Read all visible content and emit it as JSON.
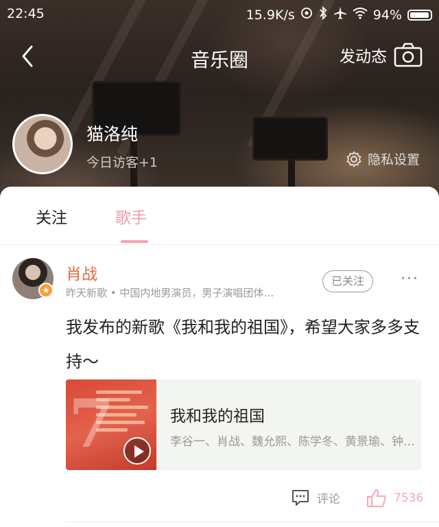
{
  "status_bar": {
    "time": "22:45",
    "network_speed": "15.9K/s",
    "battery": "94%"
  },
  "nav": {
    "title": "音乐圈",
    "post_label": "发动态"
  },
  "profile": {
    "name": "猫洛纯",
    "visits": "今日访客+1",
    "privacy_label": "隐私设置"
  },
  "tabs": [
    {
      "label": "关注"
    },
    {
      "label": "歌手",
      "active": true
    }
  ],
  "post": {
    "author": "肖战",
    "meta": "昨天新歌 • 中国内地男演员，男子演唱团体…",
    "follow_status": "已关注",
    "more": "···",
    "text": "我发布的新歌《我和我的祖国》，希望大家多多支持～",
    "song": {
      "title": "我和我的祖国",
      "artists": "李谷一、肖战、魏允熙、陈学冬、黄景瑜、钟…"
    },
    "comment_label": "评论",
    "like_count": "7536"
  },
  "colors": {
    "accent_pink": "#f09aa8",
    "author_orange": "#e2683d"
  }
}
